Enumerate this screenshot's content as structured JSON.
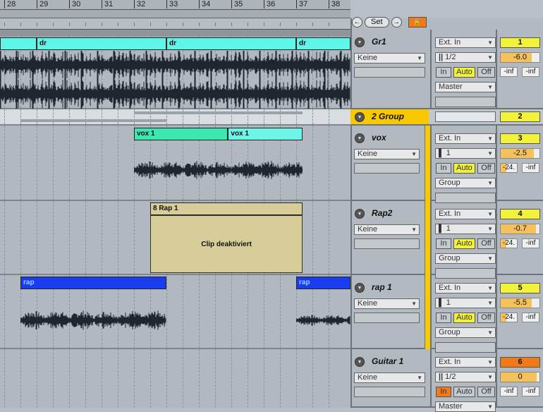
{
  "ruler": {
    "bars": [
      "28",
      "29",
      "30",
      "31",
      "32",
      "33",
      "34",
      "35",
      "36",
      "37",
      "38"
    ]
  },
  "controls": {
    "prev_icon": "arrow-left-icon",
    "set_label": "Set",
    "next_icon": "arrow-right-icon",
    "lock_icon": "lock-icon"
  },
  "colors": {
    "drums": "#5ff5e8",
    "vox_a": "#3de8b0",
    "vox_b": "#6ef5e8",
    "rap": "#1a3cf0",
    "disabled": "#d6cd98",
    "group": "#f8c800",
    "num_yellow": "#f2f23a",
    "num_orange": "#f07a18",
    "vol": "#f4c15a"
  },
  "arrangement": {
    "gr1_clips": [
      {
        "label": "",
        "start": 27.5,
        "end": 29,
        "color": "drums"
      },
      {
        "label": "dr",
        "start": 29,
        "end": 33,
        "color": "drums"
      },
      {
        "label": "dr",
        "start": 33,
        "end": 37,
        "color": "drums"
      },
      {
        "label": "dr",
        "start": 37,
        "end": 38.8,
        "color": "drums"
      }
    ],
    "vox_clips": [
      {
        "label": "vox 1",
        "start": 32,
        "end": 34.9,
        "color": "vox_a"
      },
      {
        "label": "vox 1",
        "start": 34.9,
        "end": 37.2,
        "color": "vox_b"
      }
    ],
    "rap2_clip": {
      "label": "8 Rap 1",
      "status": "Clip deaktiviert",
      "start": 32.5,
      "end": 37.2
    },
    "rap1_clips": [
      {
        "label": "rap",
        "start": 28.5,
        "end": 33,
        "color": "rap"
      },
      {
        "label": "rap",
        "start": 37,
        "end": 38.8,
        "color": "rap"
      }
    ]
  },
  "tracks": [
    {
      "name": "Gr1",
      "monitor": "Keine",
      "input": "Ext. In",
      "channel": "1/2",
      "channel_icon": "stereo-bars-icon",
      "in": "In",
      "auto": "Auto",
      "off": "Off",
      "active_mon": "auto",
      "output": "Master",
      "number": "1",
      "num_color": "num_yellow",
      "volume": "-6.0",
      "vol_fill": 0.8,
      "send_a": "-inf",
      "send_b": "-inf",
      "sends_fill": false
    },
    {
      "name": "vox",
      "monitor": "Keine",
      "input": "Ext. In",
      "channel": "1",
      "channel_icon": "mono-bar-icon",
      "in": "In",
      "auto": "Auto",
      "off": "Off",
      "active_mon": "auto",
      "output": "Group",
      "number": "3",
      "num_color": "num_yellow",
      "volume": "-2.5",
      "vol_fill": 0.85,
      "send_a": "-24.",
      "send_b": "-inf",
      "sends_fill": true
    },
    {
      "name": "Rap2",
      "monitor": "Keine",
      "input": "Ext. In",
      "channel": "1",
      "channel_icon": "mono-bar-icon",
      "in": "In",
      "auto": "Auto",
      "off": "Off",
      "active_mon": "auto",
      "output": "Group",
      "number": "4",
      "num_color": "num_yellow",
      "volume": "-0.7",
      "vol_fill": 0.9,
      "send_a": "-24.",
      "send_b": "-inf",
      "sends_fill": true
    },
    {
      "name": "rap 1",
      "monitor": "Keine",
      "input": "Ext. In",
      "channel": "1",
      "channel_icon": "mono-bar-icon",
      "in": "In",
      "auto": "Auto",
      "off": "Off",
      "active_mon": "auto",
      "output": "Group",
      "number": "5",
      "num_color": "num_yellow",
      "volume": "-5.5",
      "vol_fill": 0.8,
      "send_a": "-24.",
      "send_b": "-inf",
      "sends_fill": true
    },
    {
      "name": "Guitar 1",
      "monitor": "Keine",
      "input": "Ext. In",
      "channel": "1/2",
      "channel_icon": "stereo-bars-icon",
      "in": "In",
      "auto": "Auto",
      "off": "Off",
      "active_mon": "in",
      "output": "Master",
      "number": "6",
      "num_color": "num_orange",
      "volume": "0",
      "vol_fill": 0.93,
      "send_a": "-inf",
      "send_b": "-inf",
      "sends_fill": false
    }
  ],
  "group_track": {
    "name": "2 Group",
    "number": "2"
  }
}
